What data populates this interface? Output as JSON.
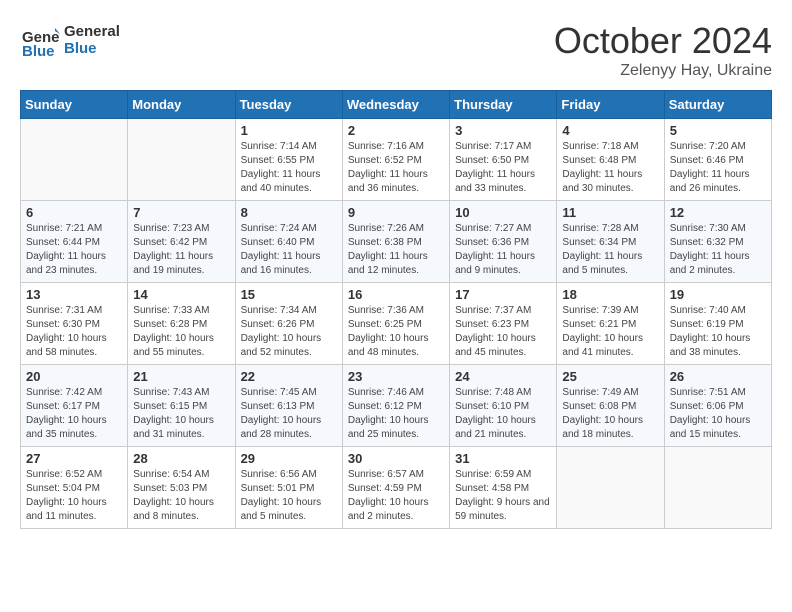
{
  "header": {
    "logo_line1": "General",
    "logo_line2": "Blue",
    "month": "October 2024",
    "location": "Zelenyy Hay, Ukraine"
  },
  "weekdays": [
    "Sunday",
    "Monday",
    "Tuesday",
    "Wednesday",
    "Thursday",
    "Friday",
    "Saturday"
  ],
  "weeks": [
    [
      {
        "day": "",
        "info": ""
      },
      {
        "day": "",
        "info": ""
      },
      {
        "day": "1",
        "info": "Sunrise: 7:14 AM\nSunset: 6:55 PM\nDaylight: 11 hours and 40 minutes."
      },
      {
        "day": "2",
        "info": "Sunrise: 7:16 AM\nSunset: 6:52 PM\nDaylight: 11 hours and 36 minutes."
      },
      {
        "day": "3",
        "info": "Sunrise: 7:17 AM\nSunset: 6:50 PM\nDaylight: 11 hours and 33 minutes."
      },
      {
        "day": "4",
        "info": "Sunrise: 7:18 AM\nSunset: 6:48 PM\nDaylight: 11 hours and 30 minutes."
      },
      {
        "day": "5",
        "info": "Sunrise: 7:20 AM\nSunset: 6:46 PM\nDaylight: 11 hours and 26 minutes."
      }
    ],
    [
      {
        "day": "6",
        "info": "Sunrise: 7:21 AM\nSunset: 6:44 PM\nDaylight: 11 hours and 23 minutes."
      },
      {
        "day": "7",
        "info": "Sunrise: 7:23 AM\nSunset: 6:42 PM\nDaylight: 11 hours and 19 minutes."
      },
      {
        "day": "8",
        "info": "Sunrise: 7:24 AM\nSunset: 6:40 PM\nDaylight: 11 hours and 16 minutes."
      },
      {
        "day": "9",
        "info": "Sunrise: 7:26 AM\nSunset: 6:38 PM\nDaylight: 11 hours and 12 minutes."
      },
      {
        "day": "10",
        "info": "Sunrise: 7:27 AM\nSunset: 6:36 PM\nDaylight: 11 hours and 9 minutes."
      },
      {
        "day": "11",
        "info": "Sunrise: 7:28 AM\nSunset: 6:34 PM\nDaylight: 11 hours and 5 minutes."
      },
      {
        "day": "12",
        "info": "Sunrise: 7:30 AM\nSunset: 6:32 PM\nDaylight: 11 hours and 2 minutes."
      }
    ],
    [
      {
        "day": "13",
        "info": "Sunrise: 7:31 AM\nSunset: 6:30 PM\nDaylight: 10 hours and 58 minutes."
      },
      {
        "day": "14",
        "info": "Sunrise: 7:33 AM\nSunset: 6:28 PM\nDaylight: 10 hours and 55 minutes."
      },
      {
        "day": "15",
        "info": "Sunrise: 7:34 AM\nSunset: 6:26 PM\nDaylight: 10 hours and 52 minutes."
      },
      {
        "day": "16",
        "info": "Sunrise: 7:36 AM\nSunset: 6:25 PM\nDaylight: 10 hours and 48 minutes."
      },
      {
        "day": "17",
        "info": "Sunrise: 7:37 AM\nSunset: 6:23 PM\nDaylight: 10 hours and 45 minutes."
      },
      {
        "day": "18",
        "info": "Sunrise: 7:39 AM\nSunset: 6:21 PM\nDaylight: 10 hours and 41 minutes."
      },
      {
        "day": "19",
        "info": "Sunrise: 7:40 AM\nSunset: 6:19 PM\nDaylight: 10 hours and 38 minutes."
      }
    ],
    [
      {
        "day": "20",
        "info": "Sunrise: 7:42 AM\nSunset: 6:17 PM\nDaylight: 10 hours and 35 minutes."
      },
      {
        "day": "21",
        "info": "Sunrise: 7:43 AM\nSunset: 6:15 PM\nDaylight: 10 hours and 31 minutes."
      },
      {
        "day": "22",
        "info": "Sunrise: 7:45 AM\nSunset: 6:13 PM\nDaylight: 10 hours and 28 minutes."
      },
      {
        "day": "23",
        "info": "Sunrise: 7:46 AM\nSunset: 6:12 PM\nDaylight: 10 hours and 25 minutes."
      },
      {
        "day": "24",
        "info": "Sunrise: 7:48 AM\nSunset: 6:10 PM\nDaylight: 10 hours and 21 minutes."
      },
      {
        "day": "25",
        "info": "Sunrise: 7:49 AM\nSunset: 6:08 PM\nDaylight: 10 hours and 18 minutes."
      },
      {
        "day": "26",
        "info": "Sunrise: 7:51 AM\nSunset: 6:06 PM\nDaylight: 10 hours and 15 minutes."
      }
    ],
    [
      {
        "day": "27",
        "info": "Sunrise: 6:52 AM\nSunset: 5:04 PM\nDaylight: 10 hours and 11 minutes."
      },
      {
        "day": "28",
        "info": "Sunrise: 6:54 AM\nSunset: 5:03 PM\nDaylight: 10 hours and 8 minutes."
      },
      {
        "day": "29",
        "info": "Sunrise: 6:56 AM\nSunset: 5:01 PM\nDaylight: 10 hours and 5 minutes."
      },
      {
        "day": "30",
        "info": "Sunrise: 6:57 AM\nSunset: 4:59 PM\nDaylight: 10 hours and 2 minutes."
      },
      {
        "day": "31",
        "info": "Sunrise: 6:59 AM\nSunset: 4:58 PM\nDaylight: 9 hours and 59 minutes."
      },
      {
        "day": "",
        "info": ""
      },
      {
        "day": "",
        "info": ""
      }
    ]
  ]
}
